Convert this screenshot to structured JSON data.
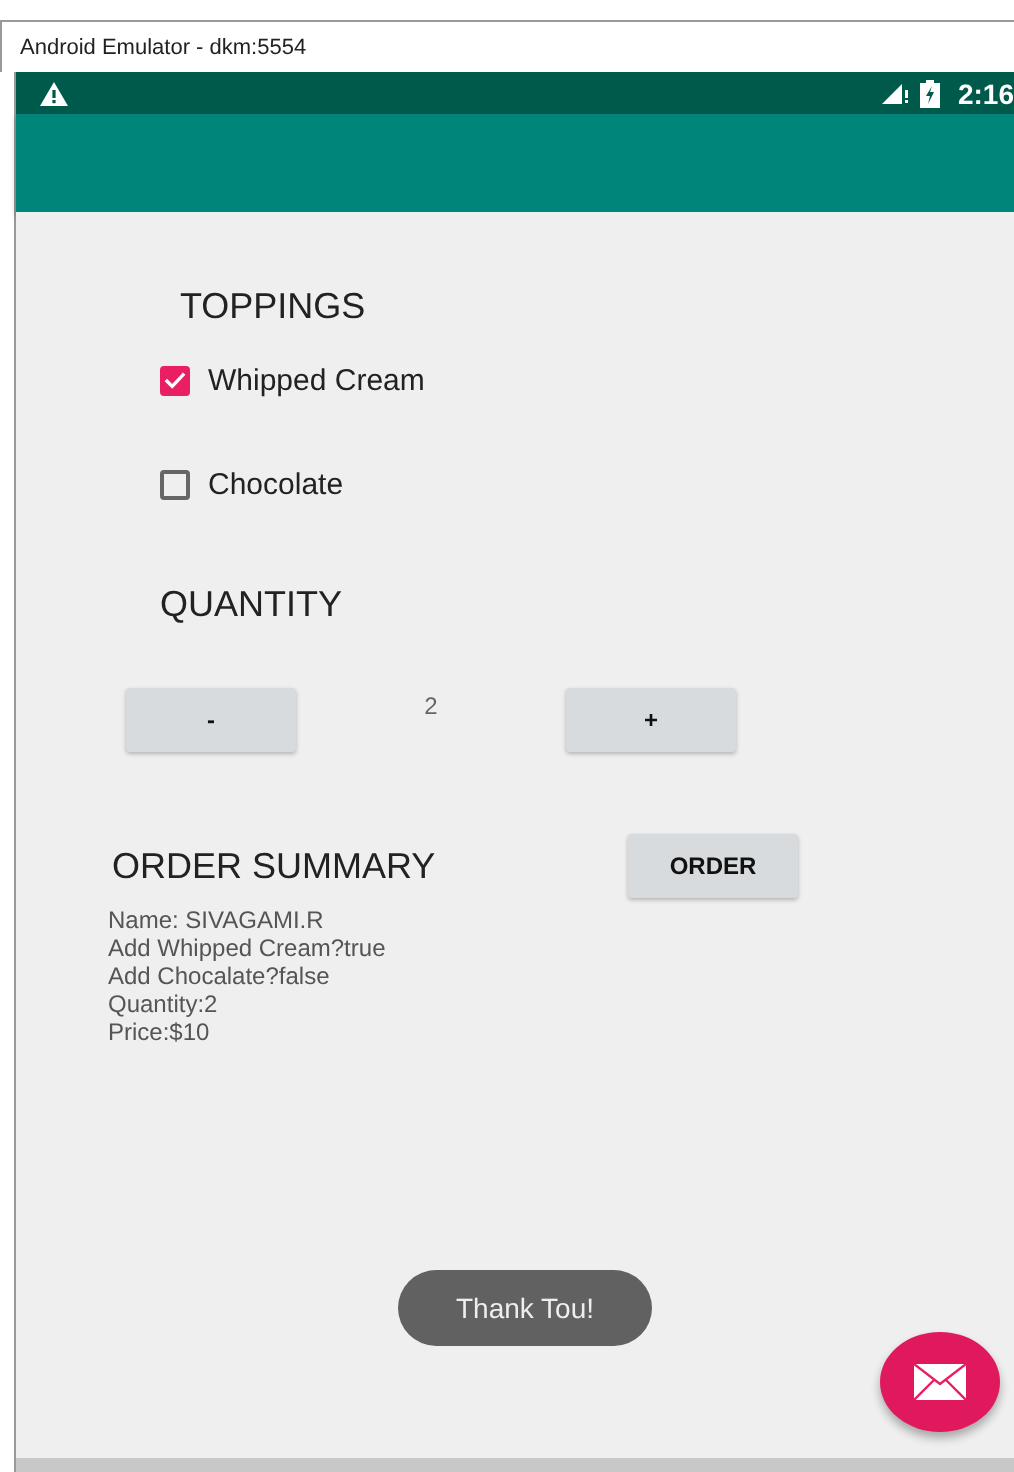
{
  "window": {
    "title": "Android Emulator - dkm:5554"
  },
  "status_bar": {
    "time": "2:16"
  },
  "toppings": {
    "heading": "TOPPINGS",
    "items": [
      {
        "label": "Whipped Cream",
        "checked": true
      },
      {
        "label": "Chocolate",
        "checked": false
      }
    ]
  },
  "quantity": {
    "heading": "QUANTITY",
    "decrement": "-",
    "value": "2",
    "increment": "+"
  },
  "order_summary": {
    "heading": "ORDER SUMMARY",
    "button": "ORDER",
    "lines": [
      " Name: SIVAGAMI.R",
      "Add Whipped Cream?true",
      "Add Chocalate?false",
      "Quantity:2",
      "Price:$10"
    ]
  },
  "toast": "Thank Tou!"
}
